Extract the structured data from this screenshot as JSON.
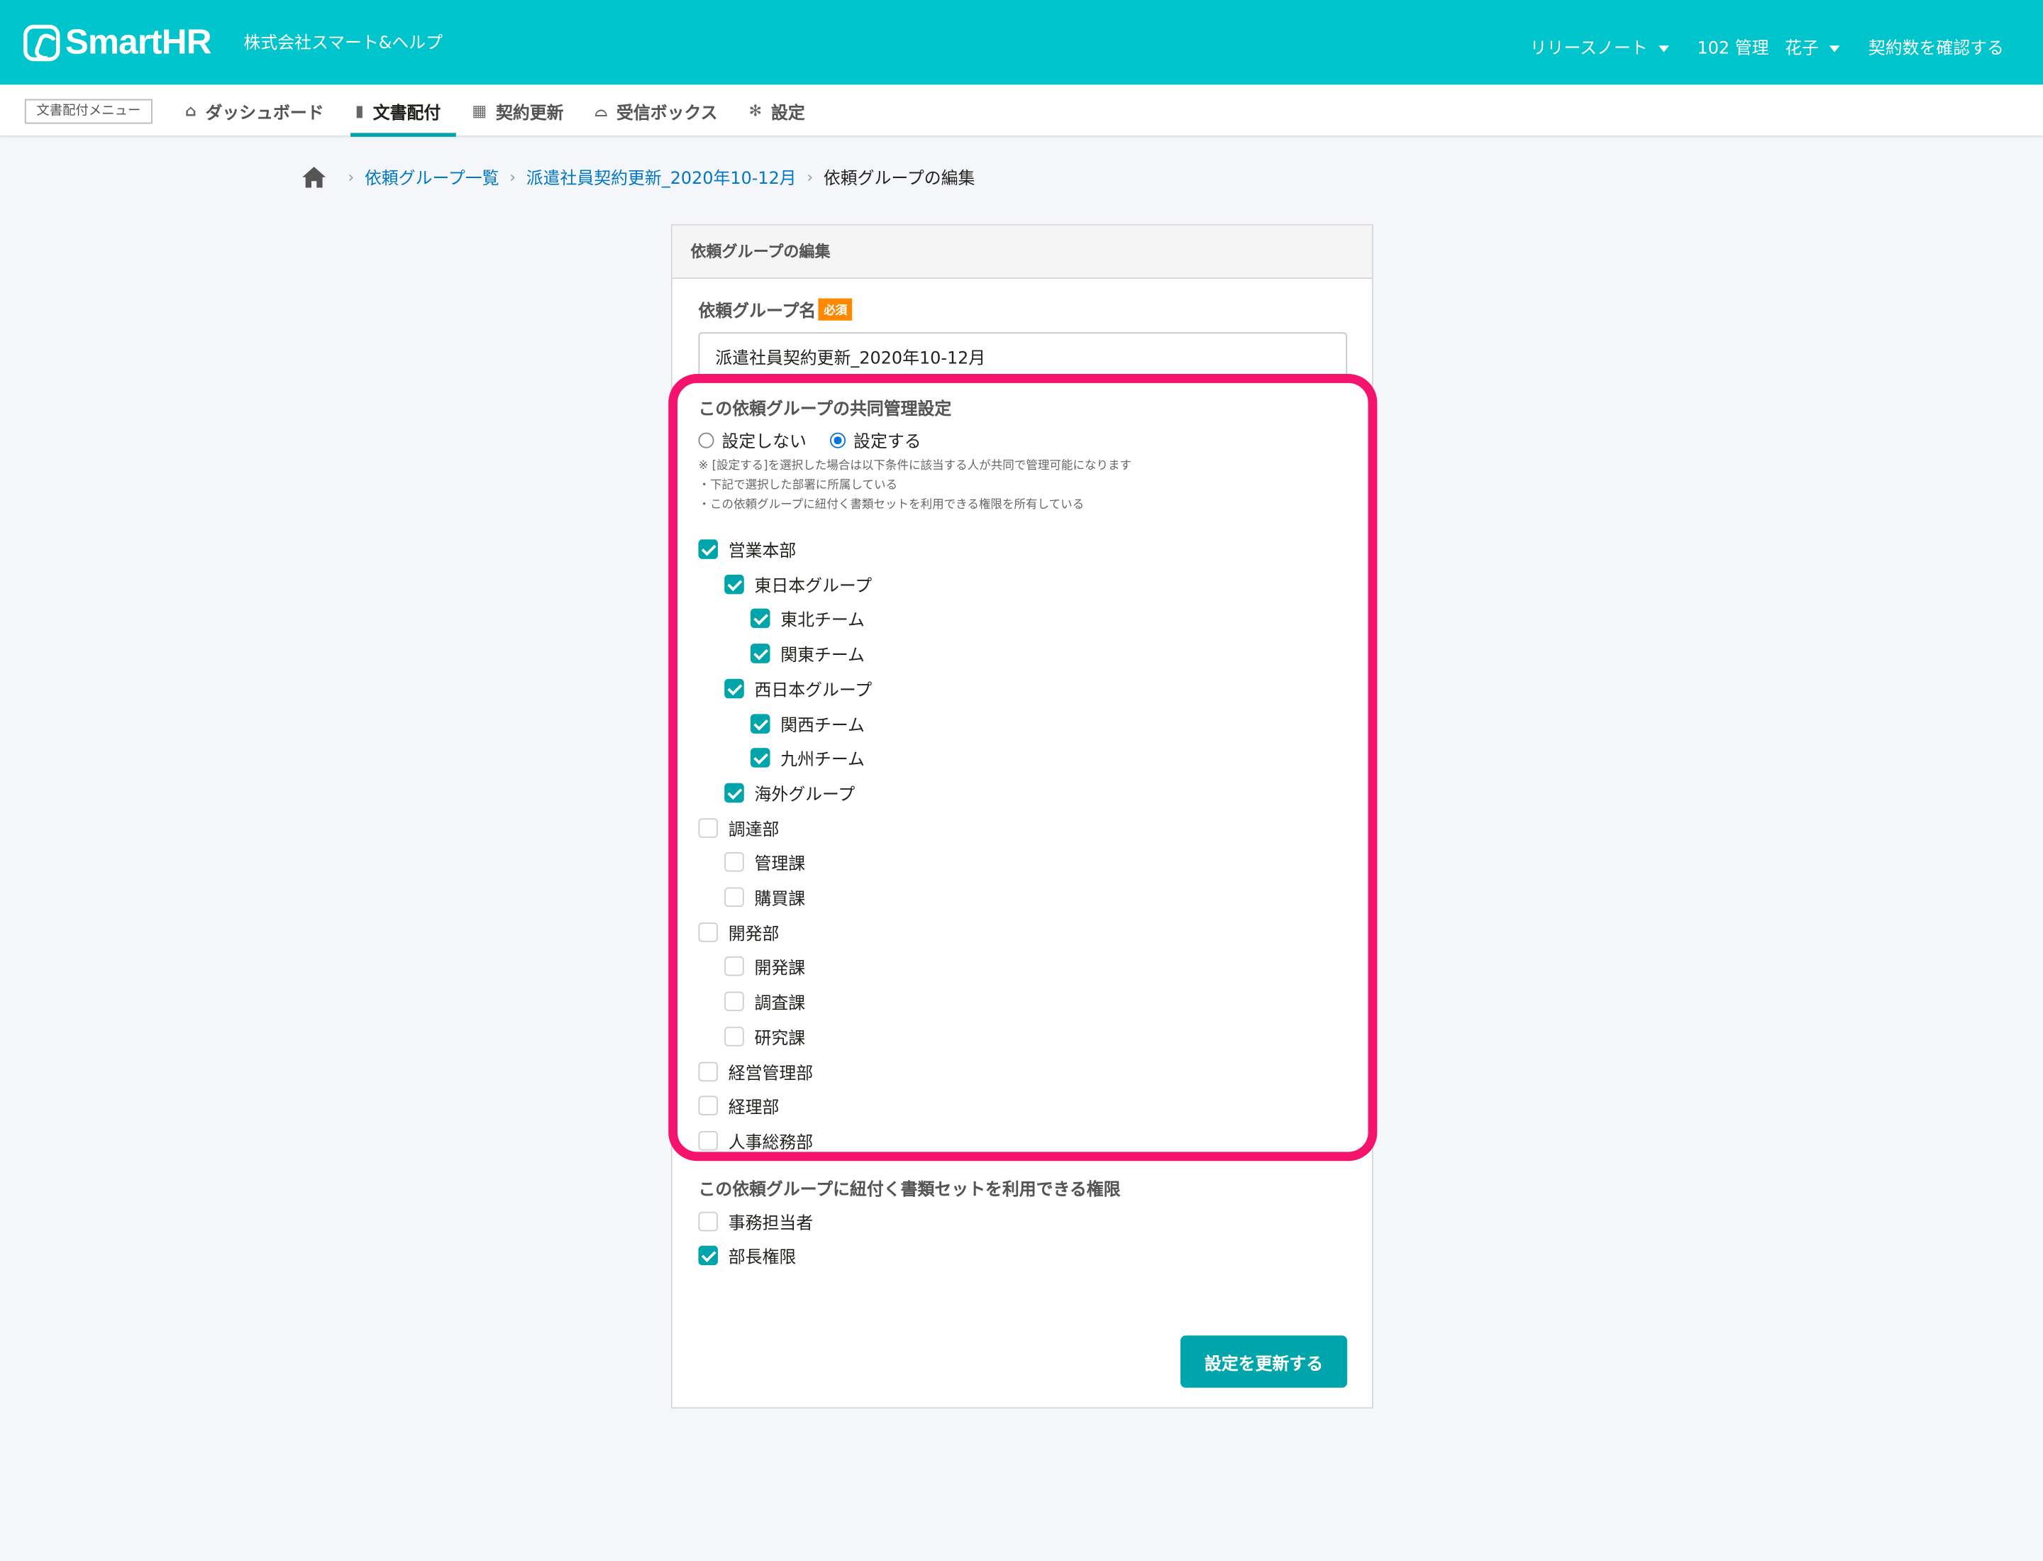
{
  "header": {
    "logo_text": "SmartHR",
    "tenant": "株式会社スマート&ヘルプ",
    "release_notes": "リリースノート",
    "user_prefix": "102 管理",
    "user_name": "花子",
    "contract_link": "契約数を確認する"
  },
  "subnav": {
    "menu_label": "文書配付メニュー",
    "tabs": [
      {
        "label": "ダッシュボード",
        "icon": "home-icon"
      },
      {
        "label": "文書配付",
        "icon": "document-icon",
        "active": true
      },
      {
        "label": "契約更新",
        "icon": "calendar-check-icon"
      },
      {
        "label": "受信ボックス",
        "icon": "inbox-icon"
      },
      {
        "label": "設定",
        "icon": "gear-icon"
      }
    ]
  },
  "breadcrumb": {
    "items": [
      "依頼グループ一覧",
      "派遣社員契約更新_2020年10-12月"
    ],
    "current": "依頼グループの編集"
  },
  "card": {
    "title": "依頼グループの編集",
    "name_label": "依頼グループ名",
    "required_badge": "必須",
    "name_value": "派遣社員契約更新_2020年10-12月",
    "co_manage_title": "この依頼グループの共同管理設定",
    "radio_off": "設定しない",
    "radio_on": "設定する",
    "radio_selected": "設定する",
    "notes": [
      "※ [設定する]を選択した場合は以下条件に該当する人が共同で管理可能になります",
      "・下記で選択した部署に所属している",
      "・この依頼グループに紐付く書類セットを利用できる権限を所有している"
    ],
    "departments": [
      {
        "label": "営業本部",
        "level": 0,
        "checked": true
      },
      {
        "label": "東日本グループ",
        "level": 1,
        "checked": true
      },
      {
        "label": "東北チーム",
        "level": 2,
        "checked": true
      },
      {
        "label": "関東チーム",
        "level": 2,
        "checked": true
      },
      {
        "label": "西日本グループ",
        "level": 1,
        "checked": true
      },
      {
        "label": "関西チーム",
        "level": 2,
        "checked": true
      },
      {
        "label": "九州チーム",
        "level": 2,
        "checked": true
      },
      {
        "label": "海外グループ",
        "level": 1,
        "checked": true
      },
      {
        "label": "調達部",
        "level": 0,
        "checked": false
      },
      {
        "label": "管理課",
        "level": 1,
        "checked": false
      },
      {
        "label": "購買課",
        "level": 1,
        "checked": false
      },
      {
        "label": "開発部",
        "level": 0,
        "checked": false
      },
      {
        "label": "開発課",
        "level": 1,
        "checked": false
      },
      {
        "label": "調査課",
        "level": 1,
        "checked": false
      },
      {
        "label": "研究課",
        "level": 1,
        "checked": false
      },
      {
        "label": "経営管理部",
        "level": 0,
        "checked": false
      },
      {
        "label": "経理部",
        "level": 0,
        "checked": false
      },
      {
        "label": "人事総務部",
        "level": 0,
        "checked": false
      }
    ],
    "permission_title": "この依頼グループに紐付く書類セットを利用できる権限",
    "permissions": [
      {
        "label": "事務担当者",
        "checked": false
      },
      {
        "label": "部長権限",
        "checked": true
      }
    ],
    "submit_label": "設定を更新する"
  },
  "colors": {
    "brand": "#00c4cc",
    "accent": "#00a5ab",
    "highlight": "#f5146d",
    "link": "#0077c7"
  }
}
